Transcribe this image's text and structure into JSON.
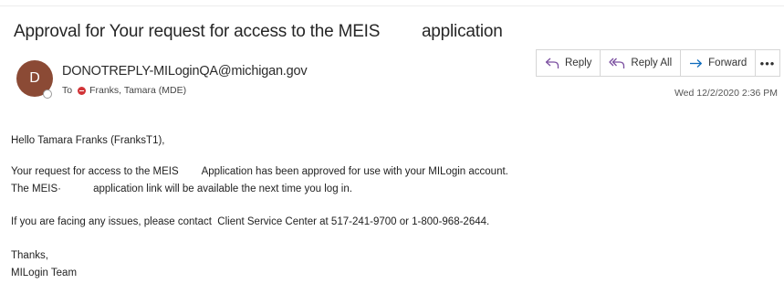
{
  "email": {
    "subject": "Approval for Your request for access to the MEIS         application",
    "sender": {
      "initial": "D",
      "address": "DONOTREPLY-MILoginQA@michigan.gov"
    },
    "to": {
      "label": "To",
      "recipient": "Franks, Tamara (MDE)"
    },
    "date": "Wed 12/2/2020 2:36 PM",
    "actions": {
      "reply": "Reply",
      "reply_all": "Reply All",
      "forward": "Forward",
      "more": "•••"
    },
    "body": {
      "greeting": "Hello Tamara Franks (FranksT1),",
      "line1": "Your request for access to the MEIS        Application has been approved for use with your MILogin account.",
      "line2": "The MEIS·           application link will be available the next time you log in.",
      "line3": "If you are facing any issues, please contact  Client Service Center at 517-241-9700 or 1-800-968-2644.",
      "signoff": "Thanks,",
      "signature": "MILogin Team"
    }
  },
  "colors": {
    "avatar": "#8b4a35",
    "icon_accent": "#7b4fa0",
    "forward_accent": "#0f6cbd",
    "blocked": "#d13438"
  }
}
